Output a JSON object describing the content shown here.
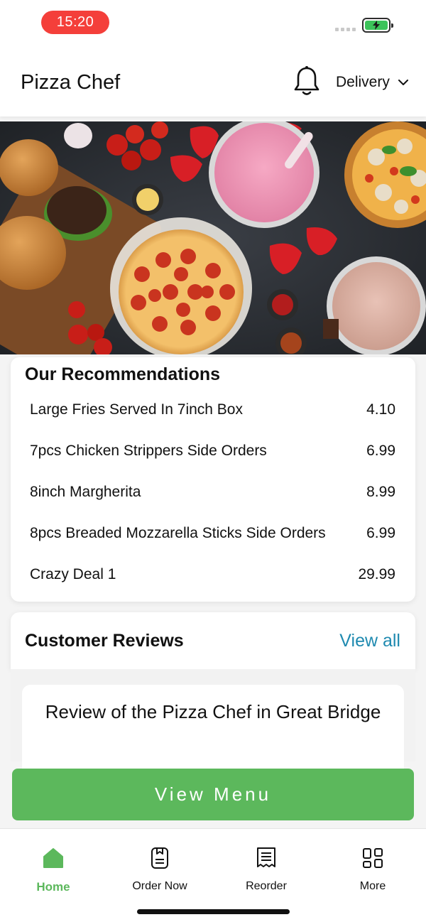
{
  "status": {
    "time": "15:20"
  },
  "header": {
    "title": "Pizza Chef",
    "bell_icon": "bell-icon",
    "delivery_label": "Delivery"
  },
  "hero": {
    "image": "food-banner-pizza-burgers-milkshakes"
  },
  "recommendations": {
    "title": "Our Recommendations",
    "items": [
      {
        "name": "Large Fries Served In 7inch Box",
        "price": "4.10"
      },
      {
        "name": "7pcs Chicken Strippers Side Orders",
        "price": "6.99"
      },
      {
        "name": "8inch Margherita",
        "price": "8.99"
      },
      {
        "name": "8pcs Breaded Mozzarella Sticks Side Orders",
        "price": "6.99"
      },
      {
        "name": "Crazy Deal 1",
        "price": "29.99"
      }
    ]
  },
  "reviews": {
    "title": "Customer Reviews",
    "view_all": "View all",
    "card_title": "Review of the Pizza Chef in Great Bridge"
  },
  "cta": {
    "label": "View Menu"
  },
  "tabs": [
    {
      "label": "Home",
      "icon": "home-icon",
      "active": true
    },
    {
      "label": "Order Now",
      "icon": "order-icon",
      "active": false
    },
    {
      "label": "Reorder",
      "icon": "receipt-icon",
      "active": false
    },
    {
      "label": "More",
      "icon": "grid-icon",
      "active": false
    }
  ],
  "colors": {
    "accent": "#5cb85c",
    "link": "#1f8ab0",
    "time_pill": "#f43f3a"
  }
}
